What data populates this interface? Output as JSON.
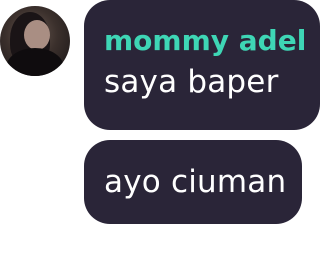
{
  "messages": [
    {
      "sender": "mommy adel",
      "text": "saya baper"
    },
    {
      "text": "ayo ciuman"
    }
  ],
  "colors": {
    "bubble_bg": "#2a2538",
    "sender_name": "#3ed6b5",
    "message_text": "#ffffff"
  }
}
